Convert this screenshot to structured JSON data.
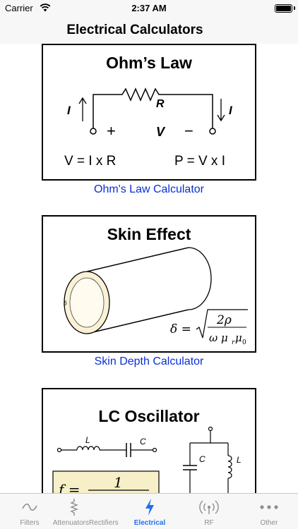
{
  "status_bar": {
    "carrier": "Carrier",
    "time": "2:37 AM"
  },
  "nav": {
    "title": "Electrical Calculators"
  },
  "cards": [
    {
      "title": "Ohm’s Law",
      "label_current_left": "I",
      "label_resistor": "R",
      "label_voltage": "V",
      "label_plus": "+",
      "label_minus": "−",
      "label_current_right": "I",
      "formula_left": "V = I x R",
      "formula_right": "P = V x I",
      "link": "Ohm's Law Calculator"
    },
    {
      "title": "Skin Effect",
      "label_delta": "δ",
      "formula_lhs": "δ =",
      "formula_num": "2ρ",
      "formula_den": "ω μ",
      "formula_sub_r": "r",
      "formula_mu0": "μ",
      "formula_sub_0": "0",
      "link": "Skin Depth Calculator"
    },
    {
      "title": "LC Oscillator",
      "label_l": "L",
      "label_c": "C",
      "label_c2": "C",
      "label_l2": "L",
      "formula_f": "f =",
      "formula_num": "1"
    }
  ],
  "tabs": [
    {
      "label": "Filters",
      "icon": "wave-icon",
      "active": false
    },
    {
      "label": "Attenuators",
      "icon": "resistor-icon",
      "active": false
    },
    {
      "label": "Rectifiers",
      "icon": "none",
      "active": false
    },
    {
      "label": "Electrical",
      "icon": "lightning-icon",
      "active": true
    },
    {
      "label": "RF",
      "icon": "antenna-icon",
      "active": false
    },
    {
      "label": "Other",
      "icon": "ellipsis-icon",
      "active": false
    }
  ],
  "colors": {
    "link": "#0a2fd6",
    "tab_active": "#1f6ff0",
    "tab_inactive": "#8e8e93",
    "bar_bg": "#f7f7f7"
  }
}
